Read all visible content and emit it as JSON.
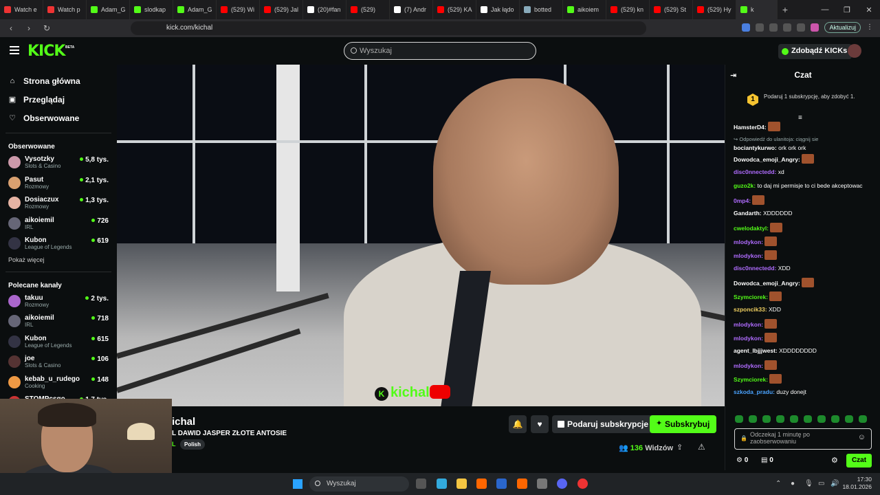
{
  "browser": {
    "tabs": [
      {
        "label": "Watch e",
        "color": "#e33"
      },
      {
        "label": "Watch p",
        "color": "#e33"
      },
      {
        "label": "Adam_G",
        "color": "#53fc18"
      },
      {
        "label": "slodkap",
        "color": "#53fc18"
      },
      {
        "label": "Adam_G",
        "color": "#53fc18"
      },
      {
        "label": "(529) Wi",
        "color": "#f00"
      },
      {
        "label": "(529) Jal",
        "color": "#f00"
      },
      {
        "label": "(20)#fan",
        "color": "#fff"
      },
      {
        "label": "(529)",
        "color": "#f00"
      },
      {
        "label": "(7) Andr",
        "color": "#fff"
      },
      {
        "label": "(529) KA",
        "color": "#f00"
      },
      {
        "label": "Jak łądo",
        "color": "#fff"
      },
      {
        "label": "botted",
        "color": "#8ab"
      },
      {
        "label": "aikoiem",
        "color": "#53fc18"
      },
      {
        "label": "(529) kn",
        "color": "#f00"
      },
      {
        "label": "(529) St",
        "color": "#f00"
      },
      {
        "label": "(529) Hy",
        "color": "#f00"
      },
      {
        "label": "k",
        "color": "#53fc18"
      }
    ],
    "new_tab": "+",
    "url": "kick.com/kichal",
    "update_label": "Aktualizuj",
    "window_controls": [
      "—",
      "❐",
      "✕"
    ]
  },
  "site": {
    "logo": "KICK",
    "beta": "BETA",
    "search_placeholder": "Wyszukaj",
    "kicks_button": "Zdobądź KICKs"
  },
  "sidebar": {
    "nav": [
      {
        "label": "Strona główna",
        "icon": "⌂"
      },
      {
        "label": "Przeglądaj",
        "icon": "▣"
      },
      {
        "label": "Obserwowane",
        "icon": "♡"
      }
    ],
    "followed_title": "Obserwowane",
    "followed": [
      {
        "name": "Vysotzky",
        "category": "Slots & Casino",
        "viewers": "5,8 tys.",
        "color": "#c9a"
      },
      {
        "name": "Pasut",
        "category": "Rozmowy",
        "viewers": "2,1 tys.",
        "color": "#d9a070"
      },
      {
        "name": "Dosiaczux",
        "category": "Rozmowy",
        "viewers": "1,3 tys.",
        "color": "#e6b3a3"
      },
      {
        "name": "aikoiemil",
        "category": "IRL",
        "viewers": "726",
        "color": "#667"
      },
      {
        "name": "Kubon",
        "category": "League of Legends",
        "viewers": "619",
        "color": "#334"
      }
    ],
    "show_more": "Pokaż więcej",
    "recommended_title": "Polecane kanały",
    "recommended": [
      {
        "name": "takuu",
        "category": "Rozmowy",
        "viewers": "2 tys.",
        "color": "#a6c"
      },
      {
        "name": "aikoiemil",
        "category": "IRL",
        "viewers": "718",
        "color": "#667"
      },
      {
        "name": "Kubon",
        "category": "League of Legends",
        "viewers": "615",
        "color": "#334"
      },
      {
        "name": "joe",
        "category": "Slots & Casino",
        "viewers": "106",
        "color": "#533"
      },
      {
        "name": "kebab_u_rudego",
        "category": "Cooking",
        "viewers": "148",
        "color": "#e94"
      },
      {
        "name": "STOMPcsgo",
        "category": "",
        "viewers": "1,7 tys.",
        "color": "#c33"
      }
    ]
  },
  "stream": {
    "name": "ichal",
    "title": "L DAWID JASPER ZŁOTE ANTOSIE",
    "language_prefix": "L",
    "tag": "Polish",
    "watermark": "kichal",
    "gift_label": "Podaruj subskrypcje",
    "subscribe_label": "Subskrybuj",
    "viewers_count": "136",
    "viewers_label": "Widzów"
  },
  "chat": {
    "title": "Czat",
    "pinned_text": "Podaruj 1 subskrypcję, aby zdobyć 1.",
    "pinned_badge": "1",
    "messages": [
      {
        "user": "HamsterD4:",
        "text": "",
        "color": "#fff",
        "emote": true
      },
      {
        "reply": "Odpowiedź do ulanitoja: ciągnij sie",
        "user": "bociantykurwo:",
        "text": "ork ork ork",
        "color": "#fff"
      },
      {
        "user": "Dowodca_emoji_Angry:",
        "text": "",
        "color": "#fff",
        "emote": true
      },
      {
        "user": "disc0nnectedd:",
        "text": "xd",
        "color": "#b06cff"
      },
      {
        "user": "guzo2k:",
        "text": "to daj mi permisje to ci bede akceptowac",
        "color": "#53fc18"
      },
      {
        "user": "0mp4:",
        "text": "",
        "color": "#b06cff",
        "emote": true
      },
      {
        "user": "Gandarth:",
        "text": "XDDDDDD",
        "color": "#fff"
      },
      {
        "user": "cwelodaktyl:",
        "text": "",
        "color": "#53fc18",
        "emote": true
      },
      {
        "user": "mlodykon:",
        "text": "",
        "color": "#b06cff",
        "emote": true
      },
      {
        "user": "mlodykon:",
        "text": "",
        "color": "#b06cff",
        "emote": true
      },
      {
        "user": "disc0nnectedd:",
        "text": "XDD",
        "color": "#b06cff"
      },
      {
        "user": "Dowodca_emoji_Angry:",
        "text": "",
        "color": "#fff",
        "emote": true
      },
      {
        "user": "Szymciorek:",
        "text": "",
        "color": "#53fc18",
        "emote": true
      },
      {
        "user": "szponcik33:",
        "text": "XDD",
        "color": "#f0d060"
      },
      {
        "user": "mlodykon:",
        "text": "",
        "color": "#b06cff",
        "emote": true
      },
      {
        "user": "mlodykon:",
        "text": "",
        "color": "#b06cff",
        "emote": true
      },
      {
        "user": "agent_lbjjjwest:",
        "text": "XDDDDDDDD",
        "color": "#fff"
      },
      {
        "user": "mlodykon:",
        "text": "",
        "color": "#b06cff",
        "emote": true
      },
      {
        "user": "Szymciorek:",
        "text": "",
        "color": "#53fc18",
        "emote": true
      },
      {
        "user": "szkoda_pradu:",
        "text": "duzy donejt",
        "color": "#4aa3ff"
      }
    ],
    "input_placeholder": "Odczekaj 1 minutę po zaobserwowaniu",
    "points_a": "0",
    "points_b": "0",
    "send_label": "Czat"
  },
  "taskbar": {
    "search_placeholder": "Wyszukaj",
    "time": "17:30",
    "date": "18.01.2026"
  }
}
